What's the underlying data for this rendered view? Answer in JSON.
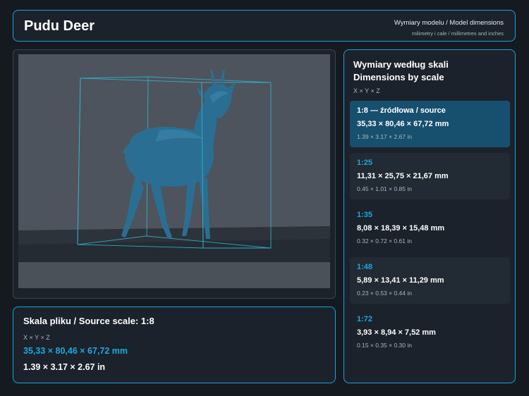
{
  "header": {
    "title": "Pudu Deer",
    "subtitle": "Wymiary modelu / Model dimensions",
    "units_note": "milimetry i cale / millimetres and inches"
  },
  "source_scale": {
    "title": "Skala pliku / Source scale: 1:8",
    "axes": "X × Y × Z",
    "mm": "35,33 × 80,46 × 67,72 mm",
    "inches": "1.39 × 3.17 × 2.67 in"
  },
  "scales_panel": {
    "title_pl": "Wymiary według skali",
    "title_en": "Dimensions by scale",
    "axes": "X × Y × Z",
    "items": [
      {
        "name": "1:8  —  źródłowa / source",
        "mm": "35,33 × 80,46 × 67,72 mm",
        "inches": "1.39 × 3.17 × 2.67 in",
        "selected": true
      },
      {
        "name": "1:25",
        "mm": "11,31 × 25,75 × 21,67 mm",
        "inches": "0.45 × 1.01 × 0.85 in",
        "selected": false
      },
      {
        "name": "1:35",
        "mm": "8,08 × 18,39 × 15,48 mm",
        "inches": "0.32 × 0.72 × 0.61 in",
        "selected": false
      },
      {
        "name": "1:48",
        "mm": "5,89 × 13,41 × 11,29 mm",
        "inches": "0.23 × 0.53 × 0.44 in",
        "selected": false
      },
      {
        "name": "1:72",
        "mm": "3,93 × 8,94 × 7,52 mm",
        "inches": "0.15 × 0.35 × 0.30 in",
        "selected": false
      }
    ]
  },
  "colors": {
    "accent": "#1ea7e0",
    "selected_card": "#17506f",
    "model": "#2a6f93",
    "bbox": "#2fb7cf"
  },
  "icons": {
    "model": "deer-model-render"
  }
}
